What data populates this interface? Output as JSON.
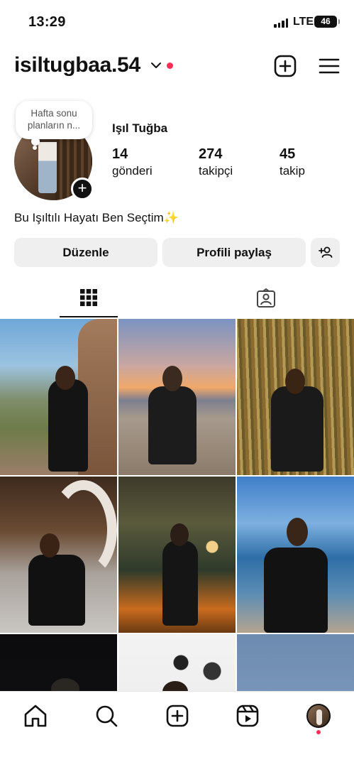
{
  "status_bar": {
    "time": "13:29",
    "network": "LTE",
    "battery": "46"
  },
  "header": {
    "username": "isiltugbaa.54",
    "icons": [
      "chevron-down-icon",
      "create-plus-icon",
      "menu-icon"
    ]
  },
  "profile": {
    "note": "Hafta sonu planların n...",
    "full_name": "Işıl Tuğba",
    "stats": {
      "posts": {
        "value": "14",
        "label": "gönderi"
      },
      "followers": {
        "value": "274",
        "label": "takipçi"
      },
      "following": {
        "value": "45",
        "label": "takip"
      }
    },
    "bio": "Bu Işıltılı Hayatı Ben Seçtim✨"
  },
  "actions": {
    "edit": "Düzenle",
    "share": "Profili paylaş"
  },
  "tabs": [
    {
      "name": "posts-grid",
      "icon": "grid-icon",
      "selected": true
    },
    {
      "name": "tagged",
      "icon": "tagged-person-icon",
      "selected": false
    }
  ],
  "grid": {
    "posts": 9
  },
  "bottom_nav": [
    "home-icon",
    "search-icon",
    "create-icon",
    "reels-icon",
    "profile-avatar"
  ],
  "colors": {
    "accent_red": "#ff2d55",
    "button_bg": "#efefef",
    "text": "#111111"
  }
}
